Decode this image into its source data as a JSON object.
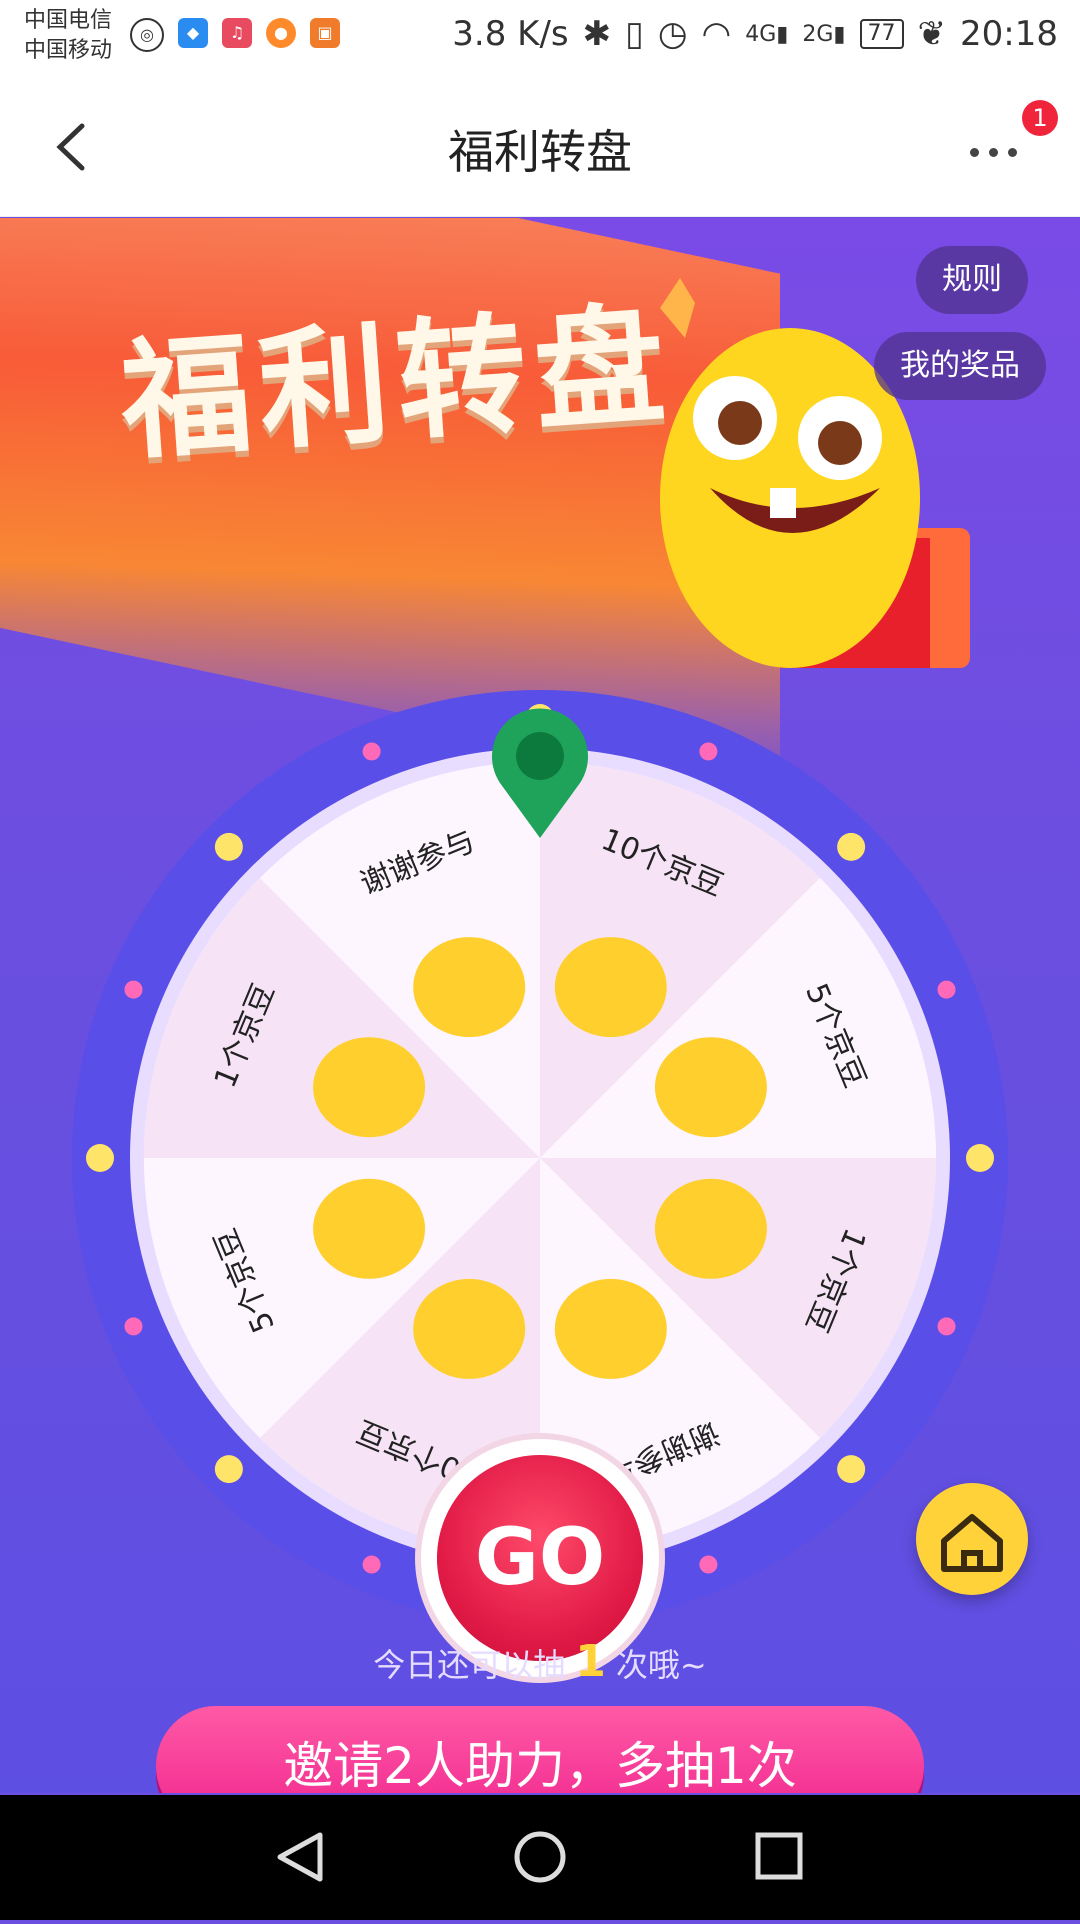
{
  "status_bar": {
    "carrier1": "中国电信",
    "carrier2": "中国移动",
    "speed": "3.8 K/s",
    "battery": "77",
    "time": "20:18",
    "signal1": "4G",
    "signal2": "2G"
  },
  "nav": {
    "title": "福利转盘",
    "badge": "1"
  },
  "banner": {
    "headline": "福利转盘",
    "rules_label": "规则",
    "prizes_label": "我的奖品"
  },
  "wheel": {
    "segments": [
      "10个京豆",
      "5个京豆",
      "1个京豆",
      "谢谢参与",
      "10个京豆",
      "5个京豆",
      "1个京豆",
      "谢谢参与"
    ],
    "go_label": "GO"
  },
  "footer": {
    "chances_prefix": "今日还可以抽",
    "chances_count": "1",
    "chances_suffix": "次哦~",
    "invite_label": "邀请2人助力，多抽1次"
  },
  "colors": {
    "accent_pink": "#f0268e",
    "go_red": "#e01945",
    "rim_blue": "#5a4ee8",
    "light_yellow": "#ffd23a"
  }
}
